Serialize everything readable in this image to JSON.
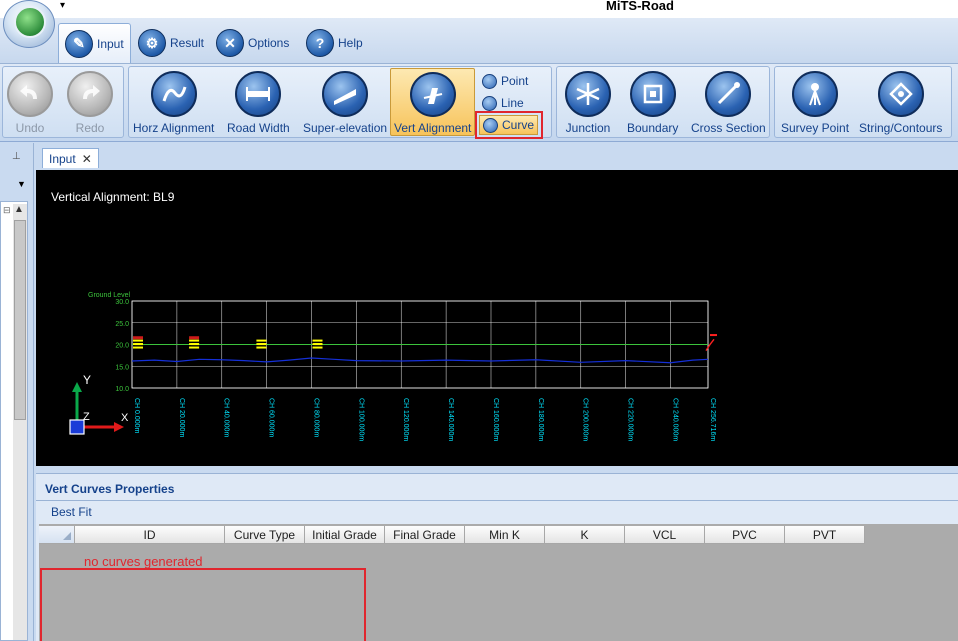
{
  "app": {
    "title": "MiTS-Road"
  },
  "tabs": [
    {
      "label": "Input",
      "icon": "input-doc-icon",
      "active": true
    },
    {
      "label": "Result",
      "icon": "gear-icon",
      "active": false
    },
    {
      "label": "Options",
      "icon": "tools-icon",
      "active": false
    },
    {
      "label": "Help",
      "icon": "question-icon",
      "active": false
    }
  ],
  "ribbon": {
    "undo": {
      "label": "Undo",
      "icon": "undo-icon",
      "enabled": false
    },
    "redo": {
      "label": "Redo",
      "icon": "redo-icon",
      "enabled": false
    },
    "horz_alignment": {
      "label": "Horz Alignment",
      "icon": "horizontal-alignment-icon"
    },
    "road_width": {
      "label": "Road Width",
      "icon": "road-width-icon"
    },
    "super_elevation": {
      "label": "Super-elevation",
      "icon": "super-elevation-icon"
    },
    "vert_alignment": {
      "label": "Vert Alignment",
      "icon": "vertical-alignment-icon",
      "selected": true
    },
    "point": {
      "label": "Point",
      "icon": "point-icon"
    },
    "line": {
      "label": "Line",
      "icon": "line-icon"
    },
    "curve": {
      "label": "Curve",
      "icon": "curve-icon",
      "selected": true
    },
    "junction": {
      "label": "Junction",
      "icon": "junction-icon"
    },
    "boundary": {
      "label": "Boundary",
      "icon": "boundary-icon"
    },
    "cross_section": {
      "label": "Cross Section",
      "icon": "cross-section-icon"
    },
    "survey_point": {
      "label": "Survey Point",
      "icon": "survey-point-icon"
    },
    "string_contours": {
      "label": "String/Contours",
      "icon": "string-contours-icon"
    }
  },
  "document": {
    "tab_label": "Input",
    "close_glyph": "✕",
    "viewport_title": "Vertical Alignment: BL9",
    "profile": {
      "ground_level_label": "Ground Level",
      "y_ticks": [
        "30.0",
        "25.0",
        "20.0",
        "15.0",
        "10.0"
      ],
      "chainages": [
        "CH 0.000m",
        "CH 20.000m",
        "CH 40.000m",
        "CH 60.000m",
        "CH 80.000m",
        "CH 100.000m",
        "CH 120.000m",
        "CH 140.000m",
        "CH 160.000m",
        "CH 180.000m",
        "CH 200.000m",
        "CH 220.000m",
        "CH 240.000m",
        "CH 256.716m"
      ],
      "axis_y_label": "Y",
      "axis_z_label": "Z",
      "axis_x_label": "X",
      "colors": {
        "grid": "#ffffff",
        "ground": "#1530d8",
        "level": "#3cc43c",
        "chainage": "#00e5ff",
        "marker": "#ffff00",
        "end": "#ff2020"
      }
    }
  },
  "properties": {
    "title": "Vert Curves Properties",
    "best_fit": "Best Fit",
    "columns": [
      "ID",
      "Curve Type",
      "Initial Grade",
      "Final Grade",
      "Min K",
      "K",
      "VCL",
      "PVC",
      "PVT"
    ],
    "annotation": "no curves generated"
  }
}
